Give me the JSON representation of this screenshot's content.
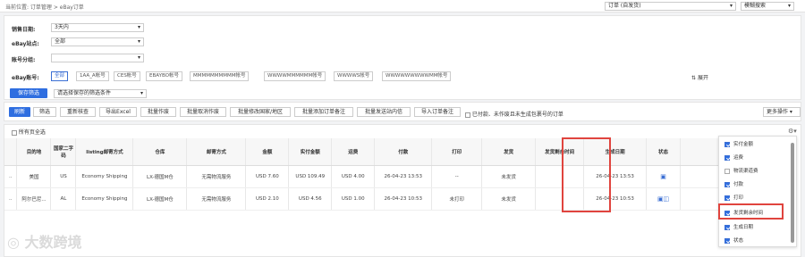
{
  "breadcrumb": "当前位置: 订单管理 > eBay订单",
  "top": {
    "order_select": "订单 (自发货)",
    "search_mode": "模糊搜索"
  },
  "filters": {
    "sale_date_label": "销售日期:",
    "sale_date_value": "3天内",
    "site_label": "eBay站点:",
    "site_value": "全部",
    "account_group_label": "账号分组:",
    "account_group_value": "",
    "account_label": "eBay账号:",
    "accounts": [
      "全部",
      "1AA_A帐号",
      "CES帐号",
      "EBAYBO帐号",
      "MMMMMMMMMM帐号",
      "WWWWMMMMMM帐号",
      "WWWWS帐号",
      "WWWWWWWWWMM帐号"
    ],
    "expand_label": "展开",
    "save_filter_btn": "保存筛选",
    "save_filter_placeholder": "请选择保存的筛选条件"
  },
  "actions": {
    "buttons": [
      "刷新",
      "筛选",
      "重新核查",
      "导出Excel",
      "批量作废",
      "批量取消作废",
      "批量修改国家/地区",
      "批量添加订单备注",
      "批量发送站内信",
      "导入订单备注"
    ],
    "unpaid_label": "已付款、未作废且未生成包裹号的订单",
    "more_ops": "更多操作"
  },
  "table": {
    "all_page_label": "所有页全选",
    "columns": [
      "目的地",
      "国家二字码",
      "listing邮寄方式",
      "仓库",
      "邮寄方式",
      "金额",
      "实付金额",
      "运费",
      "付款",
      "打印",
      "发货",
      "发货剩余时间",
      "生成日期",
      "状态"
    ],
    "rows": [
      {
        "dest": "美国",
        "code": "US",
        "listing_ship": "Economy Shipping",
        "warehouse": "LX-德国M仓",
        "ship": "无需物流服务",
        "amount": "USD 7.60",
        "paid": "USD 109.49",
        "freight": "USD 4.00",
        "pay": "26-04-23 13:53",
        "print": "--",
        "send": "未发货",
        "remain": "",
        "created": "26-04-23 13:53"
      },
      {
        "dest": "阿尔巴尼...",
        "code": "AL",
        "listing_ship": "Economy Shipping",
        "warehouse": "LX-德国M仓",
        "ship": "无需物流服务",
        "amount": "USD 2.10",
        "paid": "USD 4.56",
        "freight": "USD 1.00",
        "pay": "26-04-23 10:53",
        "print": "未打印",
        "send": "未发货",
        "remain": "",
        "created": "26-04-23 10:53"
      }
    ]
  },
  "column_picker": [
    {
      "label": "实付金额",
      "checked": true
    },
    {
      "label": "运费",
      "checked": true
    },
    {
      "label": "物流渠道费",
      "checked": false
    },
    {
      "label": "付款",
      "checked": true
    },
    {
      "label": "打印",
      "checked": true
    },
    {
      "label": "发货剩余时间",
      "checked": true
    },
    {
      "label": "生成日期",
      "checked": true
    },
    {
      "label": "状态",
      "checked": true
    }
  ],
  "watermark": "大数跨境",
  "colors": {
    "primary": "#2f6ee0",
    "highlight": "#e0443e"
  }
}
